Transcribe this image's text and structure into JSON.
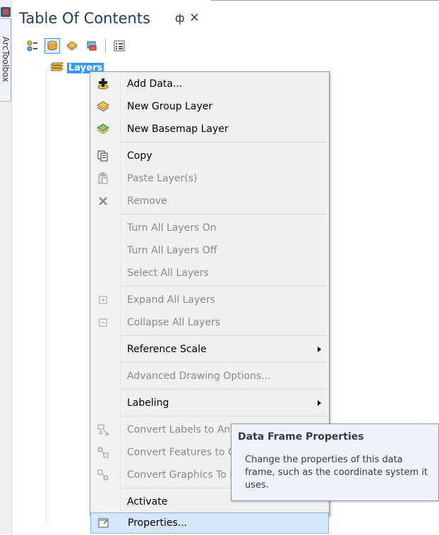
{
  "sidebar": {
    "toolbox_label": "ArcToolbox"
  },
  "toc": {
    "title": "Table Of Contents",
    "pin_glyph": "ф",
    "close_glyph": "×",
    "toolbar_icons": [
      "list-by-drawing-order-icon",
      "list-by-source-icon",
      "list-by-visibility-icon",
      "list-by-selection-icon",
      "options-icon"
    ],
    "root_layer": "Layers"
  },
  "context_menu": {
    "items": [
      {
        "label": "Add Data...",
        "icon": "add-data-icon",
        "enabled": true
      },
      {
        "label": "New Group Layer",
        "icon": "group-layer-icon",
        "enabled": true
      },
      {
        "label": "New Basemap Layer",
        "icon": "basemap-layer-icon",
        "enabled": true
      },
      {
        "label": "Copy",
        "icon": "copy-icon",
        "enabled": true
      },
      {
        "label": "Paste Layer(s)",
        "icon": "paste-icon",
        "enabled": false
      },
      {
        "label": "Remove",
        "icon": "remove-icon",
        "enabled": false
      },
      {
        "label": "Turn All Layers On",
        "enabled": false
      },
      {
        "label": "Turn All Layers Off",
        "enabled": false
      },
      {
        "label": "Select All Layers",
        "enabled": false
      },
      {
        "label": "Expand All Layers",
        "icon": "expand-icon",
        "enabled": false
      },
      {
        "label": "Collapse All Layers",
        "icon": "collapse-icon",
        "enabled": false
      },
      {
        "label": "Reference Scale",
        "enabled": true,
        "submenu": true
      },
      {
        "label": "Advanced Drawing Options...",
        "enabled": false
      },
      {
        "label": "Labeling",
        "enabled": true,
        "submenu": true
      },
      {
        "label": "Convert Labels to Annotation...",
        "icon": "convert-labels-icon",
        "enabled": false
      },
      {
        "label": "Convert Features to Graphics...",
        "icon": "convert-features-icon",
        "enabled": false
      },
      {
        "label": "Convert Graphics To Features...",
        "icon": "convert-graphics-icon",
        "enabled": false
      },
      {
        "label": "Activate",
        "enabled": true
      },
      {
        "label": "Properties...",
        "icon": "properties-icon",
        "enabled": true,
        "highlighted": true
      }
    ]
  },
  "tooltip": {
    "title": "Data Frame Properties",
    "body": "Change the properties of this data frame, such as the coordinate system it uses."
  },
  "colors": {
    "accent": "#3399ff",
    "title_text": "#1e395b",
    "disabled_text": "#8a8a8a",
    "hover_bg": "#d5e6f8"
  }
}
